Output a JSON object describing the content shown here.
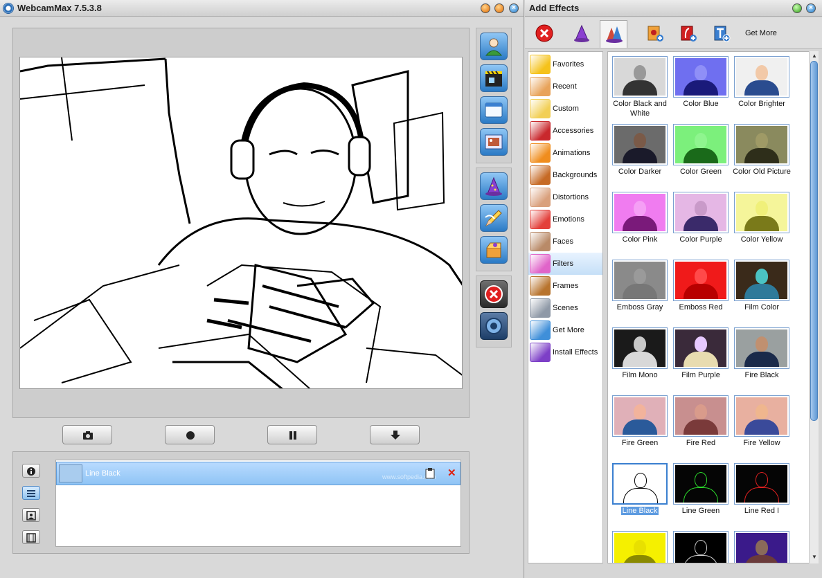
{
  "main_window": {
    "title": "WebcamMax  7.5.3.8"
  },
  "applied_effects": [
    {
      "label": "Line Black"
    }
  ],
  "effects_window": {
    "title": "Add Effects",
    "toolbar_get_more": "Get More",
    "categories": [
      {
        "label": "Favorites",
        "icon": "star-icon",
        "color": "#f5c21b"
      },
      {
        "label": "Recent",
        "icon": "clock-icon",
        "color": "#e8a35a"
      },
      {
        "label": "Custom",
        "icon": "folder-icon",
        "color": "#f2cf55"
      },
      {
        "label": "Accessories",
        "icon": "cap-icon",
        "color": "#c9282d"
      },
      {
        "label": "Animations",
        "icon": "butterfly-icon",
        "color": "#f08d1e"
      },
      {
        "label": "Backgrounds",
        "icon": "sunset-icon",
        "color": "#c66a25"
      },
      {
        "label": "Distortions",
        "icon": "distorted-face-icon",
        "color": "#d9a07c"
      },
      {
        "label": "Emotions",
        "icon": "heart-eyes-icon",
        "color": "#e3403b"
      },
      {
        "label": "Faces",
        "icon": "face-icon",
        "color": "#b98a68"
      },
      {
        "label": "Filters",
        "icon": "filter-icon",
        "color": "#e064c9"
      },
      {
        "label": "Frames",
        "icon": "frame-icon",
        "color": "#b8742e"
      },
      {
        "label": "Scenes",
        "icon": "scene-icon",
        "color": "#8f99a7"
      },
      {
        "label": "Get More",
        "icon": "globe-icon",
        "color": "#3f8fd9"
      },
      {
        "label": "Install Effects",
        "icon": "wizard-hat-icon",
        "color": "#7d3fc7"
      }
    ],
    "selected_category": "Filters",
    "effects": [
      {
        "label": "Color Black and White",
        "bg": "#d8d8d8",
        "fg": "#333333",
        "skin": "#999999"
      },
      {
        "label": "Color Blue",
        "bg": "#6f6ff0",
        "fg": "#1a1a7a",
        "skin": "#8f8ff7"
      },
      {
        "label": "Color Brighter",
        "bg": "#f0f0f0",
        "fg": "#2a4c8f",
        "skin": "#f2c9a8"
      },
      {
        "label": "Color Darker",
        "bg": "#6b6b6b",
        "fg": "#1a1a2a",
        "skin": "#7a5a48"
      },
      {
        "label": "Color Green",
        "bg": "#7cf07c",
        "fg": "#1a6a1a",
        "skin": "#8ff58f"
      },
      {
        "label": "Color Old Picture",
        "bg": "#8a8a5e",
        "fg": "#2e2e1a",
        "skin": "#9f9a66"
      },
      {
        "label": "Color Pink",
        "bg": "#f07cf0",
        "fg": "#7a1a7a",
        "skin": "#f59ff5"
      },
      {
        "label": "Color Purple",
        "bg": "#e5b7e5",
        "fg": "#3a2a6a",
        "skin": "#c99ac9"
      },
      {
        "label": "Color Yellow",
        "bg": "#f5f59a",
        "fg": "#7a7a1a",
        "skin": "#f0f07a"
      },
      {
        "label": "Emboss Gray",
        "bg": "#8a8a8a",
        "fg": "#777777",
        "skin": "#9a9a9a"
      },
      {
        "label": "Emboss Red",
        "bg": "#f01a1a",
        "fg": "#b80000",
        "skin": "#ff4a4a"
      },
      {
        "label": "Film Color",
        "bg": "#3a2a1a",
        "fg": "#2e7a9a",
        "skin": "#4bc3c3"
      },
      {
        "label": "Film Mono",
        "bg": "#1a1a1a",
        "fg": "#d8d8d8",
        "skin": "#c8c8c8"
      },
      {
        "label": "Film Purple",
        "bg": "#3a2a3a",
        "fg": "#e8dcb0",
        "skin": "#e7c9ff"
      },
      {
        "label": "Fire Black",
        "bg": "#9aa0a0",
        "fg": "#1a2a4a",
        "skin": "#c09070"
      },
      {
        "label": "Fire Green",
        "bg": "#e0b0b8",
        "fg": "#2a5a9a",
        "skin": "#f2b39c"
      },
      {
        "label": "Fire Red",
        "bg": "#c88f8f",
        "fg": "#7a3a3a",
        "skin": "#d99b8b"
      },
      {
        "label": "Fire Yellow",
        "bg": "#e8b0a0",
        "fg": "#3a4a9a",
        "skin": "#efb68e"
      },
      {
        "label": "Line Black",
        "bg": "#ffffff",
        "fg": "#ffffff",
        "skin": "#ffffff"
      },
      {
        "label": "Line Green",
        "bg": "#050505",
        "fg": "#050505",
        "skin": "#050505"
      },
      {
        "label": "Line Red I",
        "bg": "#050505",
        "fg": "#050505",
        "skin": "#050505"
      },
      {
        "label": "",
        "bg": "#f5f000",
        "fg": "#8a8a00",
        "skin": "#e8e000"
      },
      {
        "label": "",
        "bg": "#000000",
        "fg": "#000000",
        "skin": "#000000"
      },
      {
        "label": "",
        "bg": "#3a1a8a",
        "fg": "#6a3a3a",
        "skin": "#8a6a5a"
      }
    ],
    "selected_effect": "Line Black"
  }
}
